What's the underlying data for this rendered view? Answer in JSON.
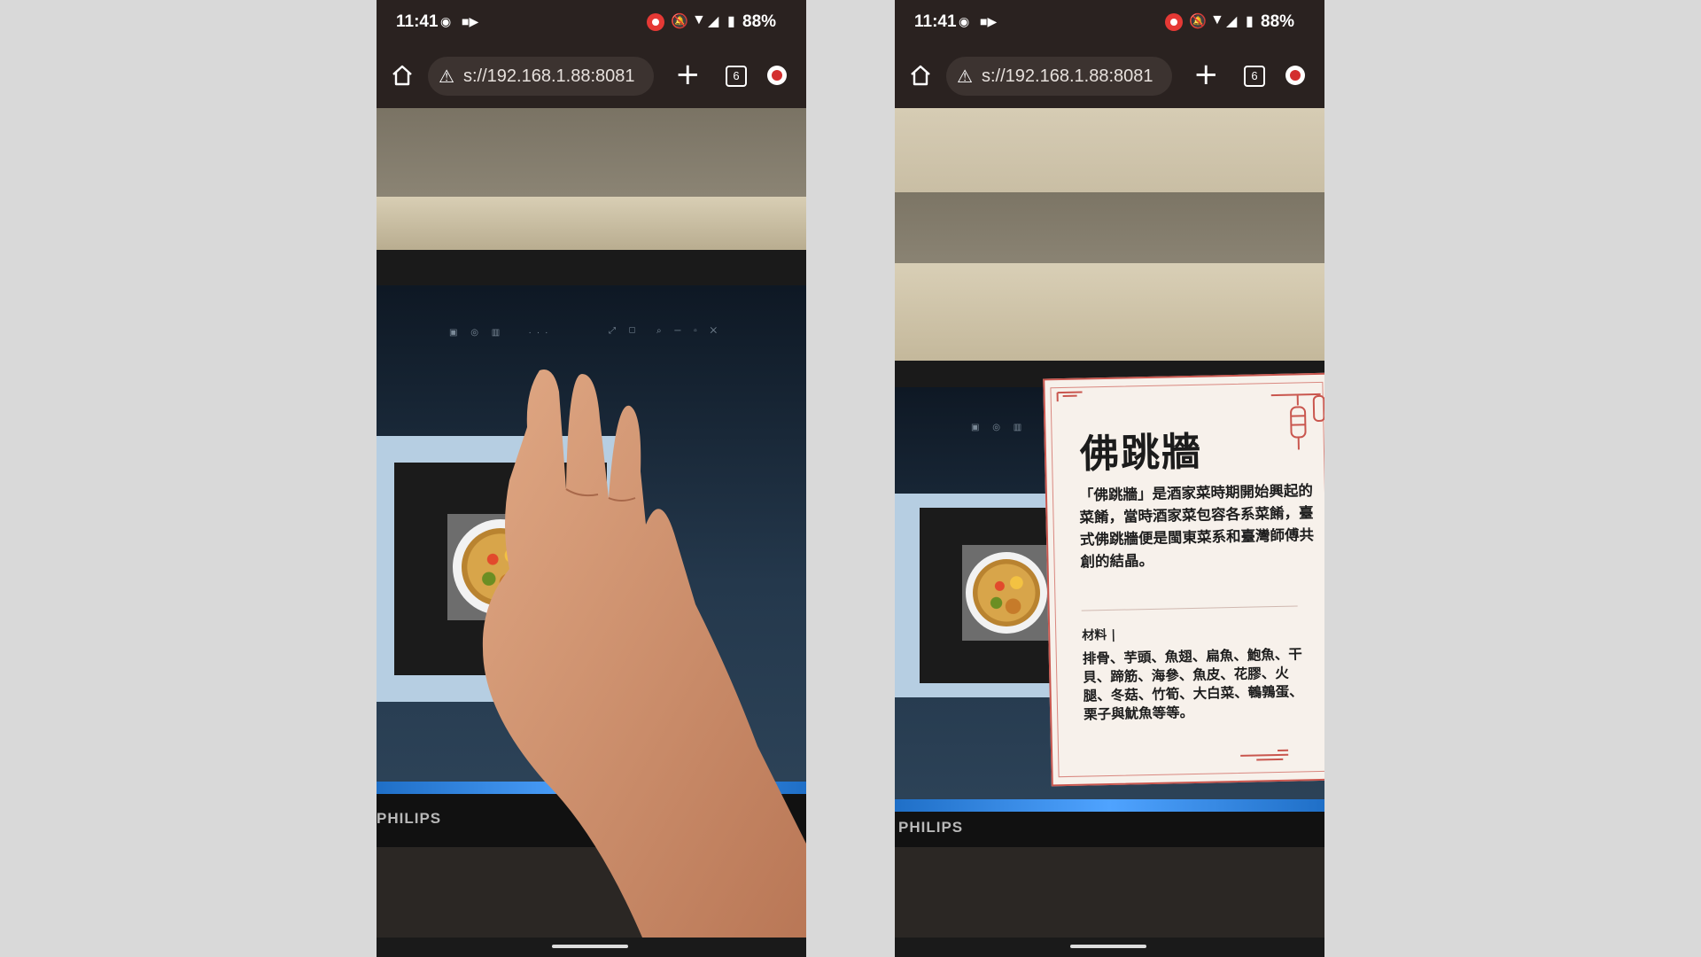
{
  "screens": [
    {
      "status": {
        "time": "11:41",
        "battery": "88%"
      },
      "browser": {
        "url": "s://192.168.1.88:8081",
        "tab_count": "6"
      },
      "scene": {
        "monitor_brand": "PHILIPS"
      }
    },
    {
      "status": {
        "time": "11:41",
        "battery": "88%"
      },
      "browser": {
        "url": "s://192.168.1.88:8081",
        "tab_count": "6"
      },
      "scene": {
        "monitor_brand": "PHILIPS"
      },
      "ar_card": {
        "title": "佛跳牆",
        "description": "「佛跳牆」是酒家菜時期開始興起的菜餚，當時酒家菜包容各系菜餚，臺式佛跳牆便是閩東菜系和臺灣師傅共創的結晶。",
        "materials_label": "材料 |",
        "materials": "排骨、芋頭、魚翅、扁魚、鮑魚、干貝、蹄筋、海參、魚皮、花膠、火腿、冬菇、竹筍、大白菜、鵪鶉蛋、栗子與魷魚等等。"
      }
    }
  ],
  "icons": {
    "home": "home-icon",
    "warning": "warning-icon",
    "new_tab": "plus-icon",
    "tabs": "tab-switcher-icon",
    "extension": "extension-icon"
  },
  "colors": {
    "browser_chrome": "#2a2220",
    "record_dot": "#e53935",
    "card_border": "#c9564e",
    "taskbar": "#1f6fc7"
  }
}
